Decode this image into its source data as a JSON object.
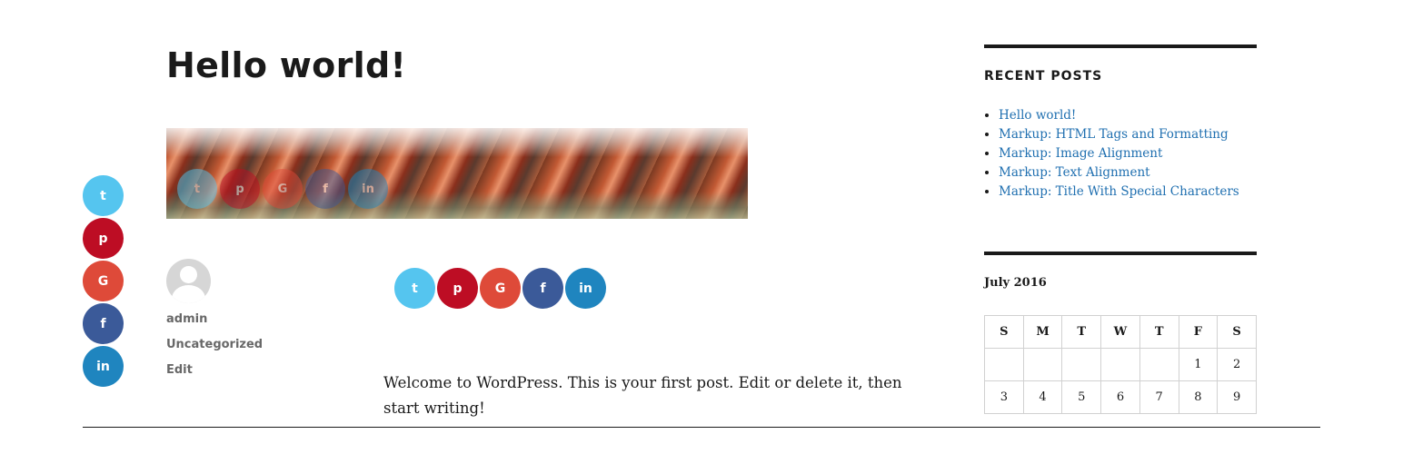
{
  "post": {
    "title": "Hello world!",
    "content": "Welcome to WordPress. This is your first post. Edit or delete it, then start writing!",
    "author": "admin",
    "category": "Uncategorized",
    "edit_label": "Edit"
  },
  "share": {
    "buttons": [
      {
        "name": "twitter",
        "glyph": "t",
        "color": "#55c5ef"
      },
      {
        "name": "pinterest",
        "glyph": "p",
        "color": "#bd0d24"
      },
      {
        "name": "google-plus",
        "glyph": "G",
        "color": "#de4a39"
      },
      {
        "name": "facebook",
        "glyph": "f",
        "color": "#3b5a99"
      },
      {
        "name": "linkedin",
        "glyph": "in",
        "color": "#1f85bf"
      }
    ]
  },
  "sidebar": {
    "recent_posts": {
      "title": "RECENT POSTS",
      "items": [
        "Hello world!",
        "Markup: HTML Tags and Formatting",
        "Markup: Image Alignment",
        "Markup: Text Alignment",
        "Markup: Title With Special Characters"
      ]
    },
    "calendar": {
      "caption": "July 2016",
      "days": [
        "S",
        "M",
        "T",
        "W",
        "T",
        "F",
        "S"
      ],
      "weeks": [
        [
          "",
          "",
          "",
          "",
          "",
          "1",
          "2"
        ],
        [
          "3",
          "4",
          "5",
          "6",
          "7",
          "8",
          "9"
        ]
      ]
    }
  },
  "colors": {
    "link": "#1f6fb0",
    "text": "#1a1a1a",
    "meta": "#686868"
  }
}
